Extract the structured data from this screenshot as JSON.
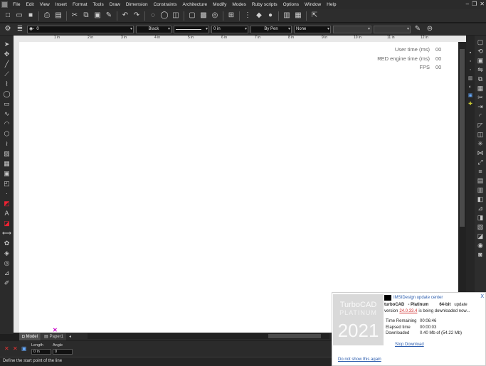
{
  "menu": [
    "File",
    "Edit",
    "View",
    "Insert",
    "Format",
    "Tools",
    "Draw",
    "Dimension",
    "Constraints",
    "Architecture",
    "Modify",
    "Modes",
    "Ruby scripts",
    "Options",
    "Window",
    "Help"
  ],
  "window_controls": [
    "–",
    "❐",
    "✕"
  ],
  "toolbar2": {
    "layer_value": "0",
    "color_value": "Black",
    "width_value": "0 in",
    "pen_value": "By Pen",
    "fill_value": "None"
  },
  "ruler_ticks": [
    "1 in",
    "2 in",
    "3 in",
    "4 in",
    "5 in",
    "6 in",
    "7 in",
    "8 in",
    "9 in",
    "10 in",
    "11 in",
    "12 in"
  ],
  "perf": {
    "user_time_label": "User time (ms)",
    "user_time_value": "00",
    "red_time_label": "RED engine time (ms)",
    "red_time_value": "00",
    "fps_label": "FPS",
    "fps_value": "00"
  },
  "tabs": [
    {
      "label": "Model"
    },
    {
      "label": "Paper1"
    }
  ],
  "inputbar": {
    "length_label": "Length",
    "length_value": "0 in",
    "angle_label": "Angle",
    "angle_value": "0"
  },
  "status": {
    "text": "Define the start point of the line"
  },
  "popup": {
    "title": "IMSIDesign update center",
    "close": "X",
    "logo_line1": "TurboCAD",
    "logo_line2": "PLATINUM",
    "logo_line3": "2021",
    "product_a": "turboCAD",
    "product_b": "- Platinum",
    "product_c": "64-bit",
    "product_d": "update",
    "version_prefix": "version",
    "version": "24.0.33.4",
    "version_suffix": "is being downloaded now...",
    "time_remaining_label": "Time Remaining",
    "time_remaining_value": "00:06:46",
    "elapsed_label": "Elapsed time",
    "elapsed_value": "00:00:03",
    "downloaded_label": "Downloaded",
    "downloaded_value": "0.40  Mb of (54.22 Mb)",
    "stop": "Stop Download",
    "dont_show": "Do not show this again"
  },
  "colors": {
    "canvas": "#ffffff",
    "ui_dark": "#2b2b2b",
    "link": "#2a5cad",
    "accent_red": "#d03030",
    "cursor_marker": "#c800c8"
  }
}
